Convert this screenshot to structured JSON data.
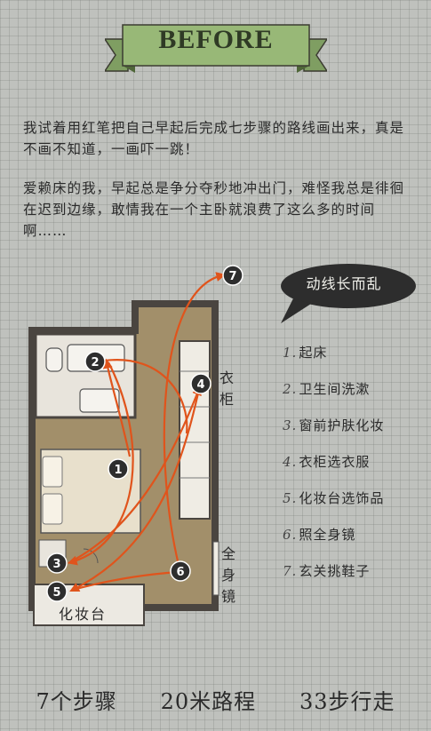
{
  "banner": {
    "title": "BEFORE"
  },
  "intro": {
    "p1": "我试着用红笔把自己早起后完成七步骤的路线画出来，真是不画不知道，一画吓一跳！",
    "p2": "爱赖床的我，早起总是争分夺秒地冲出门，难怪我总是徘徊在迟到边缘，敢情我在一个主卧就浪费了这么多的时间啊……"
  },
  "bubble": {
    "text": "动线长而乱"
  },
  "steps": [
    {
      "num": "1.",
      "label": "起床"
    },
    {
      "num": "2.",
      "label": "卫生间洗漱"
    },
    {
      "num": "3.",
      "label": "窗前护肤化妆"
    },
    {
      "num": "4.",
      "label": "衣柜选衣服"
    },
    {
      "num": "5.",
      "label": "化妆台选饰品"
    },
    {
      "num": "6.",
      "label": "照全身镜"
    },
    {
      "num": "7.",
      "label": "玄关挑鞋子"
    }
  ],
  "plan": {
    "labels": {
      "wardrobe": "衣柜",
      "mirror": "全身镜",
      "vanity": "化妆台"
    },
    "markers": [
      "1",
      "2",
      "3",
      "4",
      "5",
      "6",
      "7"
    ],
    "route_color": "#e0541c"
  },
  "footer": {
    "steps": "7个步骤",
    "distance": "20米路程",
    "walk": "33步行走"
  },
  "colors": {
    "banner": "#98b877",
    "floor": "#a28f6a",
    "wall": "#4a4540",
    "bubble": "#2d2d2d"
  }
}
